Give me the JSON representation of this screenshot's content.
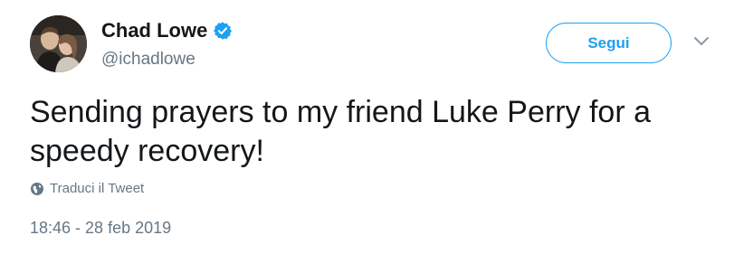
{
  "author": {
    "display_name": "Chad Lowe",
    "handle": "@ichadlowe",
    "verified_icon": "verified-badge-icon",
    "avatar_icon": "avatar-photo"
  },
  "actions": {
    "follow_label": "Segui",
    "menu_icon": "chevron-down-icon"
  },
  "tweet": {
    "text": "Sending prayers to my friend Luke Perry for a\nspeedy recovery!",
    "translate_label": "Traduci il Tweet",
    "translate_icon": "globe-icon",
    "timestamp": "18:46 - 28 feb 2019"
  },
  "colors": {
    "accent": "#1da1f2",
    "text_primary": "#14171a",
    "text_secondary": "#657786"
  }
}
